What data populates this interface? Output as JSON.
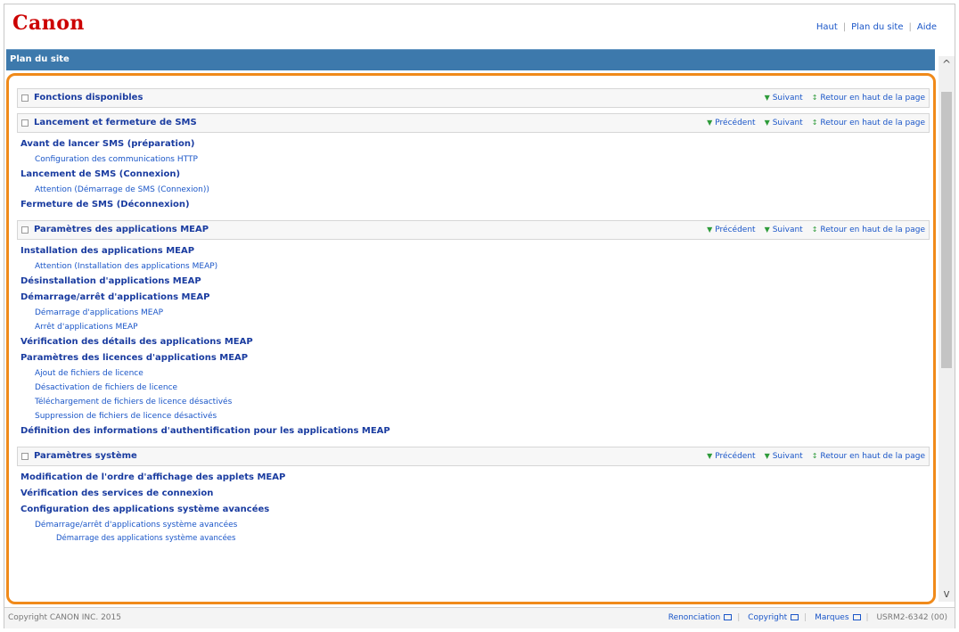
{
  "header": {
    "logo": "Canon",
    "links": [
      "Haut",
      "Plan du site",
      "Aide"
    ]
  },
  "titlebar": {
    "title": "Plan du site"
  },
  "sections": [
    {
      "title": "Fonctions disponibles",
      "nav": [
        "Suivant",
        "Retour en haut de la page"
      ],
      "items": []
    },
    {
      "title": "Lancement et fermeture de SMS",
      "nav": [
        "Précédent",
        "Suivant",
        "Retour en haut de la page"
      ],
      "items": [
        {
          "level": 1,
          "text": "Avant de lancer SMS (préparation)"
        },
        {
          "level": 2,
          "text": "Configuration des communications HTTP"
        },
        {
          "level": 1,
          "text": "Lancement de SMS (Connexion)"
        },
        {
          "level": 2,
          "text": "Attention (Démarrage de SMS (Connexion))"
        },
        {
          "level": 1,
          "text": "Fermeture de SMS (Déconnexion)"
        }
      ]
    },
    {
      "title": "Paramètres des applications MEAP",
      "nav": [
        "Précédent",
        "Suivant",
        "Retour en haut de la page"
      ],
      "items": [
        {
          "level": 1,
          "text": "Installation des applications MEAP"
        },
        {
          "level": 2,
          "text": "Attention (Installation des applications MEAP)"
        },
        {
          "level": 1,
          "text": "Désinstallation d'applications MEAP"
        },
        {
          "level": 1,
          "text": "Démarrage/arrêt d'applications MEAP"
        },
        {
          "level": 2,
          "text": "Démarrage d'applications MEAP"
        },
        {
          "level": 2,
          "text": "Arrêt d'applications MEAP"
        },
        {
          "level": 1,
          "text": "Vérification des détails des applications MEAP"
        },
        {
          "level": 1,
          "text": "Paramètres des licences d'applications MEAP"
        },
        {
          "level": 2,
          "text": "Ajout de fichiers de licence"
        },
        {
          "level": 2,
          "text": "Désactivation de fichiers de licence"
        },
        {
          "level": 2,
          "text": "Téléchargement de fichiers de licence désactivés"
        },
        {
          "level": 2,
          "text": "Suppression de fichiers de licence désactivés"
        },
        {
          "level": 1,
          "text": "Définition des informations d'authentification pour les applications MEAP"
        }
      ]
    },
    {
      "title": "Paramètres système",
      "nav": [
        "Précédent",
        "Suivant",
        "Retour en haut de la page"
      ],
      "items": [
        {
          "level": 1,
          "text": "Modification de l'ordre d'affichage des applets MEAP"
        },
        {
          "level": 1,
          "text": "Vérification des services de connexion"
        },
        {
          "level": 1,
          "text": "Configuration des applications système avancées"
        },
        {
          "level": 2,
          "text": "Démarrage/arrêt d'applications système avancées"
        },
        {
          "level": 3,
          "text": "Démarrage des applications système avancées"
        }
      ]
    }
  ],
  "footer": {
    "copyright": "Copyright CANON INC. 2015",
    "links": [
      "Renonciation",
      "Copyright",
      "Marques"
    ],
    "code": "USRM2-6342 (00)"
  },
  "colors": {
    "accent": "#cc0000",
    "titlebar": "#3d79ac",
    "highlight": "#f08a1a",
    "link": "#1a56c8"
  }
}
